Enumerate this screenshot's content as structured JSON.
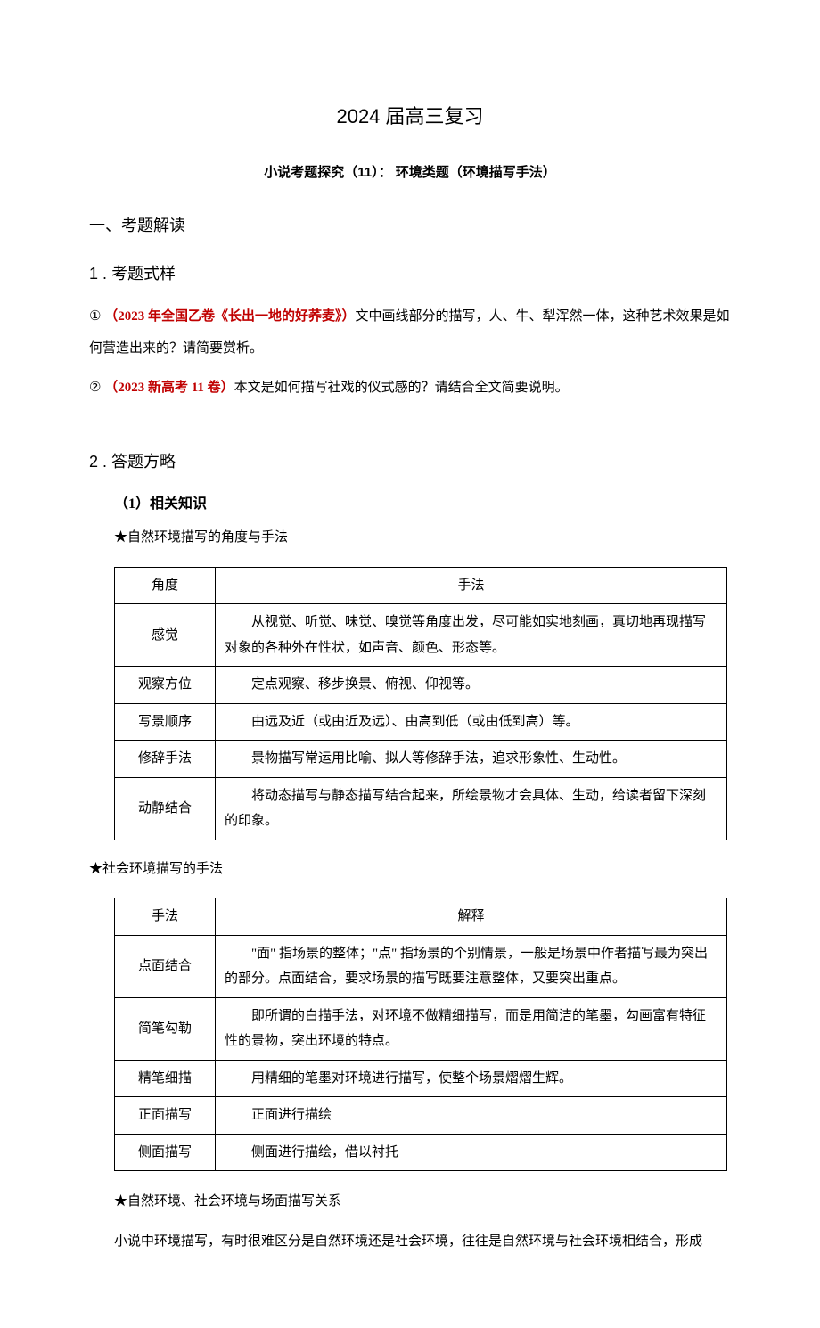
{
  "title": "2024 届高三复习",
  "subtitle": "小说考题探究（11）： 环境类题（环境描写手法）",
  "sec1": {
    "heading": "一、考题解读",
    "sub1": {
      "heading": "1 . 考题式样",
      "item1": {
        "num": "① ",
        "red": "（2023 年全国乙卷《长出一地的好荞麦》）",
        "body": "文中画线部分的描写，人、牛、犁浑然一体，这种艺术效果是如何营造出来的？请简要赏析。"
      },
      "item2": {
        "num": "② ",
        "red": "（2023 新高考 11 卷）",
        "body": "本文是如何描写社戏的仪式感的？请结合全文简要说明。"
      }
    },
    "sub2": {
      "heading": "2 . 答题方略",
      "k1": {
        "heading": "（1）相关知识",
        "star1": "★自然环境描写的角度与手法",
        "table1": {
          "header": {
            "c1": "角度",
            "c2": "手法"
          },
          "rows": [
            {
              "label": "感觉",
              "text": "从视觉、听觉、味觉、嗅觉等角度出发，尽可能如实地刻画，真切地再现描写对象的各种外在性状，如声音、颜色、形态等。"
            },
            {
              "label": "观察方位",
              "text": "定点观察、移步换景、俯视、仰视等。"
            },
            {
              "label": "写景顺序",
              "text": "由远及近（或由近及远）、由高到低（或由低到高）等。"
            },
            {
              "label": "修辞手法",
              "text": "景物描写常运用比喻、拟人等修辞手法，追求形象性、生动性。"
            },
            {
              "label": "动静结合",
              "text": "将动态描写与静态描写结合起来，所绘景物才会具体、生动，给读者留下深刻的印象。"
            }
          ]
        },
        "star2": "★社会环境描写的手法",
        "table2": {
          "header": {
            "c1": "手法",
            "c2": "解释"
          },
          "rows": [
            {
              "label": "点面结合",
              "text": "\"面\" 指场景的整体；\"点\" 指场景的个别情景，一般是场景中作者描写最为突出的部分。点面结合，要求场景的描写既要注意整体，又要突出重点。"
            },
            {
              "label": "简笔勾勒",
              "text": "即所谓的白描手法，对环境不做精细描写，而是用简洁的笔墨，勾画富有特征性的景物，突出环境的特点。"
            },
            {
              "label": "精笔细描",
              "text": "用精细的笔墨对环境进行描写，使整个场景熠熠生辉。"
            },
            {
              "label": "正面描写",
              "text": "正面进行描绘"
            },
            {
              "label": "侧面描写",
              "text": "侧面进行描绘，借以衬托"
            }
          ]
        },
        "star3": "★自然环境、社会环境与场面描写关系",
        "trailing": "小说中环境描写，有时很难区分是自然环境还是社会环境，往往是自然环境与社会环境相结合，形成"
      }
    }
  }
}
